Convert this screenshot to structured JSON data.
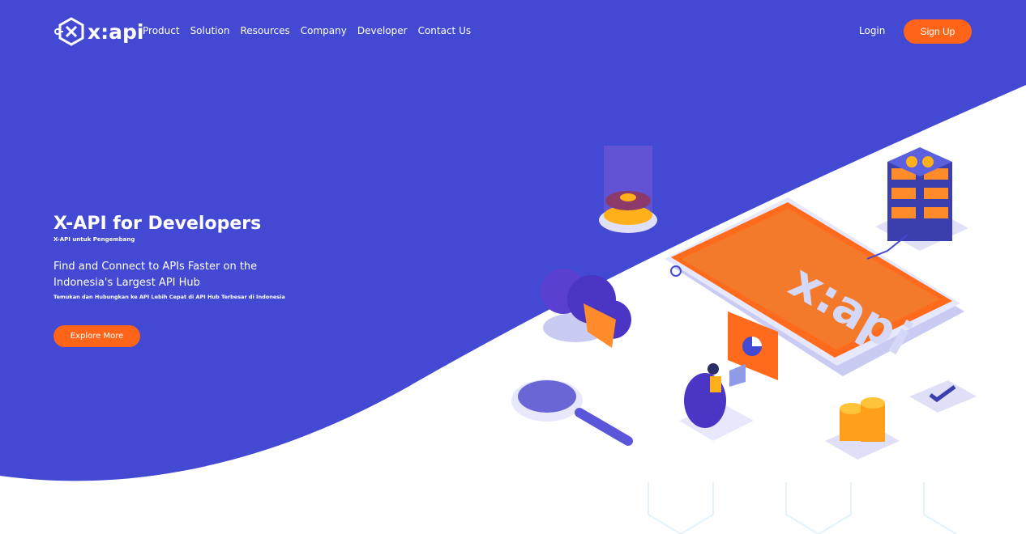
{
  "logo": {
    "text": "x:api"
  },
  "nav": {
    "items": [
      "Product",
      "Solution",
      "Resources",
      "Company",
      "Developer",
      "Contact Us"
    ],
    "login": "Login",
    "signup": "Sign Up"
  },
  "hero": {
    "title": "X-API for Developers",
    "subtitle": "X-API untuk Pengembang",
    "tagline": "Find and Connect to APIs Faster on the Indonesia's Largest API Hub",
    "tagline_sub": "Temukan dan Hubungkan ke API Lebih Cepat di API Hub Terbesar di Indonesia",
    "cta": "Explore More"
  },
  "illustration": {
    "phone_logo_text": "x:api"
  },
  "colors": {
    "primary": "#4349d2",
    "accent": "#ff6418",
    "text": "#ffffff"
  }
}
